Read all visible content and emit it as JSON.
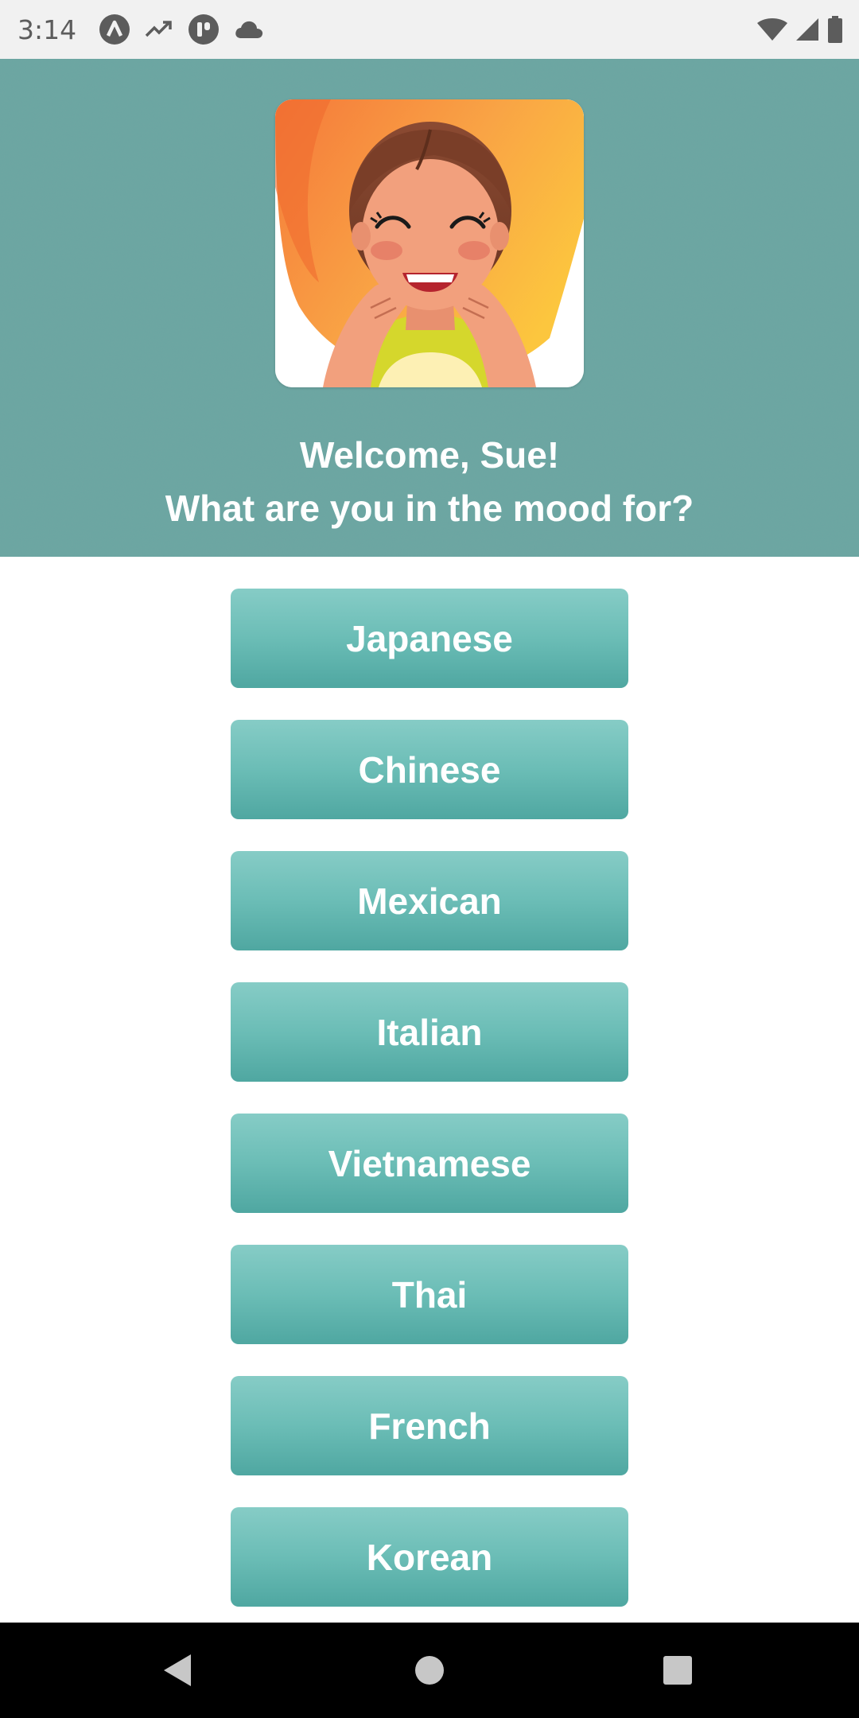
{
  "status_bar": {
    "time": "3:14",
    "icons_left": [
      "app-notification-icon",
      "trending-icon",
      "app-icon",
      "cloud-icon"
    ],
    "icons_right": [
      "wifi-icon",
      "signal-icon",
      "battery-icon"
    ]
  },
  "header": {
    "avatar_icon": "laughing-woman-illustration",
    "welcome_line1": "Welcome, Sue!",
    "welcome_line2": "What are you in the mood for?",
    "background_color": "#6aa7a3"
  },
  "cuisines": [
    {
      "label": "Japanese"
    },
    {
      "label": "Chinese"
    },
    {
      "label": "Mexican"
    },
    {
      "label": "Italian"
    },
    {
      "label": "Vietnamese"
    },
    {
      "label": "Thai"
    },
    {
      "label": "French"
    },
    {
      "label": "Korean"
    }
  ],
  "colors": {
    "button_top": "#86ccc6",
    "button_bottom": "#4fa7a1",
    "button_text": "#ffffff"
  },
  "nav_bar": {
    "icons": [
      "back-icon",
      "home-icon",
      "recents-icon"
    ]
  }
}
